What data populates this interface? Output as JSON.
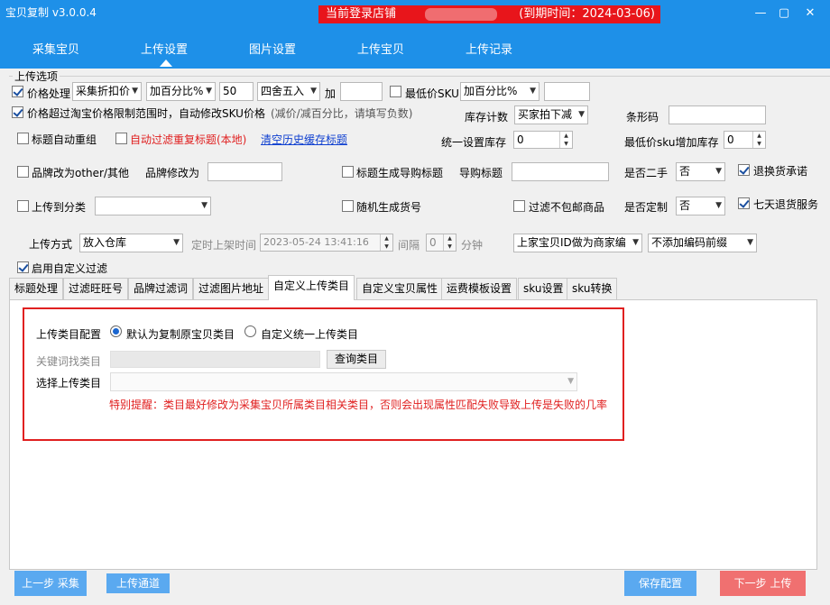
{
  "window": {
    "title": "宝贝复制 v3.0.0.4",
    "store_label": "当前登录店铺",
    "expiry": "(到期时间：2024-03-06)"
  },
  "nav": {
    "items": [
      "采集宝贝",
      "上传设置",
      "图片设置",
      "上传宝贝",
      "上传记录"
    ],
    "active": "上传设置"
  },
  "options": {
    "group_title": "上传选项",
    "price_process": {
      "label": "价格处理",
      "source": "采集折扣价",
      "method": "加百分比%",
      "value": "50",
      "rounding": "四舍五入",
      "add_label": "加",
      "add_value": ""
    },
    "lowest_sku": {
      "label": "最低价SKU",
      "method": "加百分比%",
      "value": ""
    },
    "price_exceed": {
      "label": "价格超过淘宝价格限制范围时，自动修改SKU价格",
      "hint": "(减价/减百分比，请填写负数)"
    },
    "stock_count": {
      "label": "库存计数",
      "value": "买家拍下减"
    },
    "barcode": {
      "label": "条形码",
      "value": ""
    },
    "title_regroup": {
      "label": "标题自动重组"
    },
    "filter_dup": {
      "label": "自动过滤重复标题(本地)"
    },
    "clear_cache": "清空历史缓存标题",
    "unified_stock": {
      "label": "统一设置库存",
      "value": "0"
    },
    "lowest_sku_stock": {
      "label": "最低价sku增加库存",
      "value": "0"
    },
    "brand_other": {
      "label": "品牌改为other/其他"
    },
    "brand_change": {
      "label": "品牌修改为",
      "value": ""
    },
    "guide_title_gen": {
      "label": "标题生成导购标题"
    },
    "guide_title": {
      "label": "导购标题",
      "value": ""
    },
    "second_hand": {
      "label": "是否二手",
      "value": "否"
    },
    "return_promise": {
      "label": "退换货承诺"
    },
    "upload_category": {
      "label": "上传到分类",
      "value": ""
    },
    "random_sku_no": {
      "label": "随机生成货号"
    },
    "filter_no_shipping": {
      "label": "过滤不包邮商品"
    },
    "custom_made": {
      "label": "是否定制",
      "value": "否"
    },
    "seven_day": {
      "label": "七天退货服务"
    },
    "upload_mode": {
      "label": "上传方式",
      "value": "放入仓库"
    },
    "schedule": {
      "label": "定时上架时间",
      "value": "2023-05-24 13:41:16",
      "interval_label": "间隔",
      "interval_value": "0",
      "unit": "分钟"
    },
    "merchant_code": {
      "value": "上家宝贝ID做为商家编"
    },
    "code_prefix": {
      "value": "不添加编码前缀"
    },
    "custom_filter": {
      "label": "启用自定义过滤"
    }
  },
  "tabs": [
    "标题处理",
    "过滤旺旺号",
    "品牌过滤词",
    "过滤图片地址",
    "自定义上传类目",
    "自定义宝贝属性",
    "运费模板设置",
    "sku设置",
    "sku转换"
  ],
  "active_tab": "自定义上传类目",
  "category": {
    "config_label": "上传类目配置",
    "radio_default": "默认为复制原宝贝类目",
    "radio_custom": "自定义统一上传类目",
    "keyword_label": "关键词找类目",
    "keyword_value": "",
    "query_button": "查询类目",
    "select_label": "选择上传类目",
    "select_value": "",
    "warning": "特别提醒：类目最好修改为采集宝贝所属类目相关类目，否则会出现属性匹配失败导致上传是失败的几率"
  },
  "footer": {
    "prev": "上一步 采集",
    "channel": "上传通道",
    "save": "保存配置",
    "next": "下一步 上传"
  },
  "colors": {
    "titlebar": "#1e90e8",
    "store_badge": "#e8151b",
    "button_blue": "#5aa9f0",
    "button_red": "#f07070",
    "warning_text": "#e02020"
  }
}
